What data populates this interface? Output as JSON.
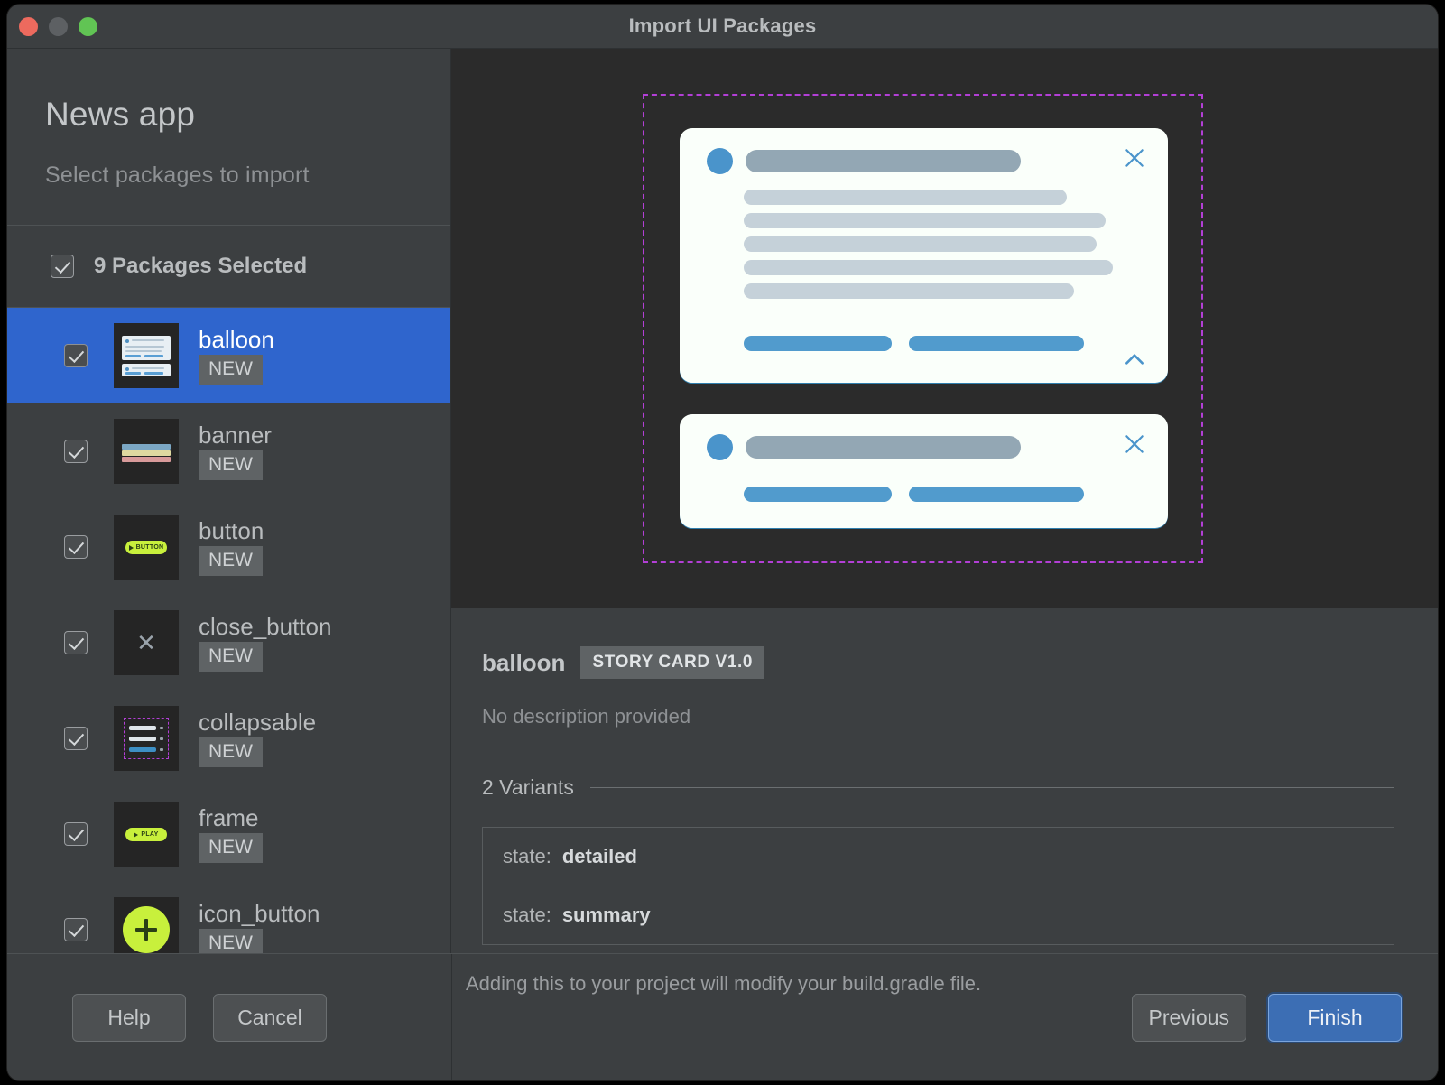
{
  "window": {
    "title": "Import UI Packages",
    "traffic_lights": [
      "close-red",
      "minimize-yellow",
      "zoom-green"
    ]
  },
  "sidebar": {
    "project_title": "News app",
    "subtitle": "Select packages to import",
    "select_all_label": "9 Packages Selected",
    "select_all_checked": true,
    "packages": [
      {
        "name": "balloon",
        "badge": "NEW",
        "checked": true,
        "selected": true,
        "thumb": "balloon-card-thumb"
      },
      {
        "name": "banner",
        "badge": "NEW",
        "checked": true,
        "selected": false,
        "thumb": "banner-bars-thumb"
      },
      {
        "name": "button",
        "badge": "NEW",
        "checked": true,
        "selected": false,
        "thumb": "button-pill-thumb",
        "pill_text": "BUTTON"
      },
      {
        "name": "close_button",
        "badge": "NEW",
        "checked": true,
        "selected": false,
        "thumb": "close-x-thumb"
      },
      {
        "name": "collapsable",
        "badge": "NEW",
        "checked": true,
        "selected": false,
        "thumb": "collapsable-rows-thumb"
      },
      {
        "name": "frame",
        "badge": "NEW",
        "checked": true,
        "selected": false,
        "thumb": "frame-play-thumb",
        "pill_text": "PLAY"
      },
      {
        "name": "icon_button",
        "badge": "NEW",
        "checked": true,
        "selected": false,
        "thumb": "icon-plus-thumb"
      }
    ]
  },
  "preview": {
    "selection_frame_color": "#b33fd6",
    "card_background": "#fafffa",
    "accent_color": "#4a94cb",
    "cards": [
      {
        "variant": "detailed",
        "close_icon": "close-x-icon",
        "expand_icon": "chevron-up-icon",
        "body_lines": 5,
        "action_buttons": 2
      },
      {
        "variant": "summary",
        "close_icon": "close-x-icon",
        "body_lines": 0,
        "action_buttons": 2
      }
    ]
  },
  "detail": {
    "name": "balloon",
    "tag": "STORY CARD V1.0",
    "description": "No description provided",
    "variants_heading": "2 Variants",
    "variant_key": "state:",
    "variants": [
      {
        "key": "state:",
        "value": "detailed"
      },
      {
        "key": "state:",
        "value": "summary"
      }
    ]
  },
  "footer": {
    "note": "Adding this to your project will modify your build.gradle file.",
    "help_label": "Help",
    "cancel_label": "Cancel",
    "previous_label": "Previous",
    "finish_label": "Finish"
  },
  "colors": {
    "window_bg": "#3c3f41",
    "preview_bg": "#2b2b2b",
    "selection_blue": "#2f65cd",
    "primary_button": "#3c6eb4",
    "accent_lime": "#c8f03c"
  }
}
